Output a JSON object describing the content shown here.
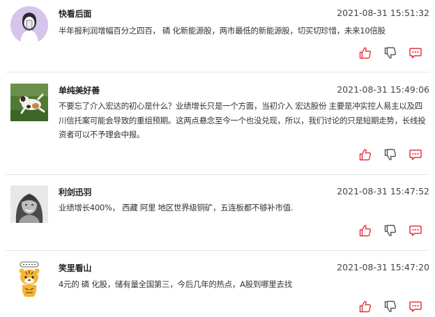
{
  "colors": {
    "accent": "#e5333b",
    "divider": "#e6e6e6",
    "text": "#333333",
    "name": "#222222"
  },
  "comments": [
    {
      "name": "快看后面",
      "time": "2021-08-31 15:51:32",
      "body": "半年报利润增幅百分之四百， 磷 化新能源股，两市最低的新能源股，切买切珍惜，未来10倍股",
      "avatar": "illustration-avatar"
    },
    {
      "name": "单纯美好善",
      "time": "2021-08-31 15:49:06",
      "body": "不要忘了介入宏达的初心是什么？业绩增长只是一个方面，当初介入 宏达股份 主要是冲实控人易主以及四川信托案可能会导致的重组预期。这两点悬念至今一个也没兑现，所以，我们讨论的只是短期走势，长线投资者可以不予理会中报。",
      "avatar": "dog-photo-avatar"
    },
    {
      "name": "利剑迅羽",
      "time": "2021-08-31 15:47:52",
      "body": "业绩增长400%， 西藏 阿里 地区世界级铜矿，五连板都不够补市值.",
      "avatar": "portrait-photo-avatar"
    },
    {
      "name": "笑里看山",
      "time": "2021-08-31 15:47:20",
      "body": "4元的 磷 化股，储有量全国第三，今后几年的热点，A股到哪里去找",
      "avatar": "cartoon-tiger-avatar"
    }
  ]
}
